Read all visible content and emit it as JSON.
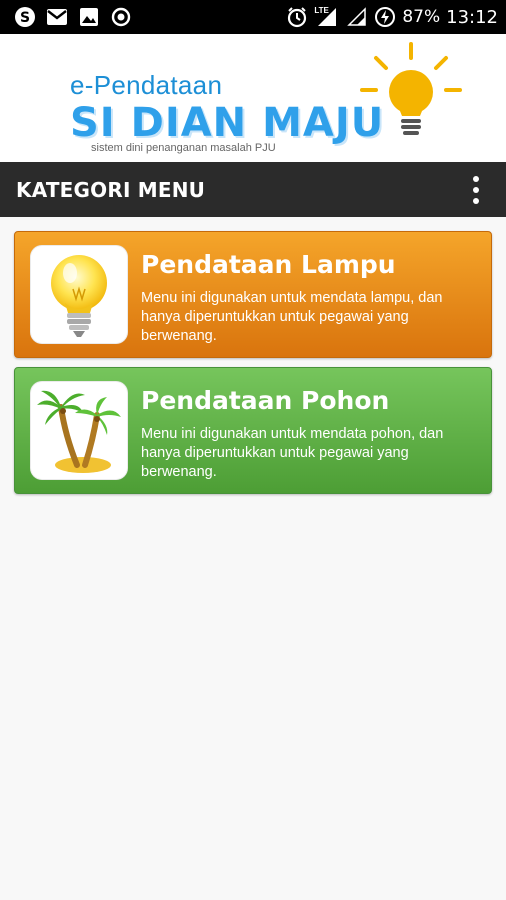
{
  "status_bar": {
    "left_icons": [
      "skype-icon",
      "gmail-icon",
      "gallery-icon",
      "record-icon"
    ],
    "network": "LTE",
    "battery": "87%",
    "time": "13:12"
  },
  "header": {
    "app_subtitle": "e-Pendataan",
    "app_name": "SI DIAN MAJU",
    "tagline": "sistem dini penanganan masalah PJU",
    "logo_icon": "light-bulb-icon",
    "accent": "#2fa0ea"
  },
  "toolbar": {
    "title": "KATEGORI MENU",
    "menu_icon": "more-vert-icon"
  },
  "menu": [
    {
      "title": "Pendataan Lampu",
      "description": "Menu ini digunakan untuk mendata lampu, dan hanya diperuntukkan untuk pegawai yang berwenang.",
      "icon": "light-bulb-icon",
      "color": "#e68a1a"
    },
    {
      "title": "Pendataan Pohon",
      "description": "Menu ini digunakan untuk mendata pohon, dan hanya diperuntukkan untuk pegawai yang berwenang.",
      "icon": "palm-tree-icon",
      "color": "#5cb043"
    }
  ]
}
